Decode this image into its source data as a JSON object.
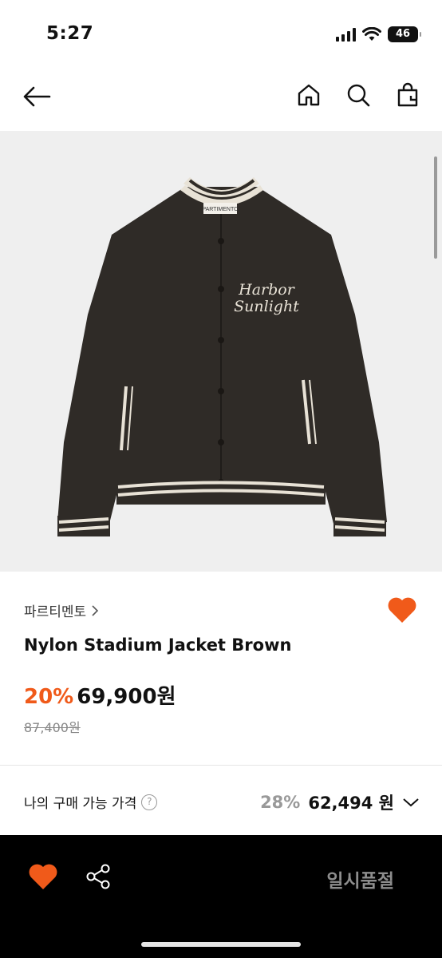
{
  "status_bar": {
    "time": "5:27",
    "battery": "46"
  },
  "nav": {
    "back_icon": "arrow-left-icon",
    "icons": [
      "home-icon",
      "search-icon",
      "bag-icon"
    ]
  },
  "product": {
    "image_text": {
      "label": "PARTIMENTO",
      "embroidery_line1": "Harbor",
      "embroidery_line2": "Sunlight"
    },
    "brand": "파르티멘토",
    "name": "Nylon Stadium Jacket Brown",
    "discount": "20%",
    "price": "69,900원",
    "original_price": "87,400원",
    "liked": true
  },
  "my_price": {
    "label": "나의 구매 가능 가격",
    "discount": "28%",
    "price": "62,494 원"
  },
  "bottom_bar": {
    "soldout_label": "일시품절"
  },
  "colors": {
    "accent": "#f05a1a",
    "jacket": "#2f2b27",
    "bg_image": "#efefef"
  }
}
